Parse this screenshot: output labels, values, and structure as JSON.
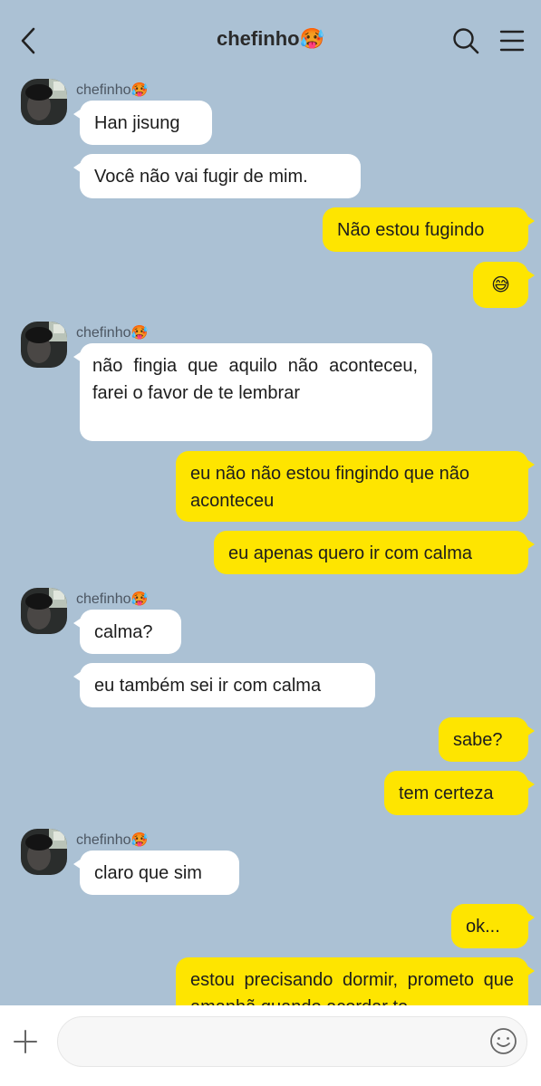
{
  "header": {
    "title": "chefinho",
    "title_emoji": "🥵"
  },
  "messages": [
    {
      "sender": "chefinho",
      "sender_emoji": "🥵",
      "text": "Han jisung"
    },
    {
      "text": "Você não vai fugir de mim."
    },
    {
      "text": "Não estou fugindo"
    },
    {
      "text": "😅"
    },
    {
      "sender": "chefinho",
      "sender_emoji": "🥵",
      "text": "não fingia que aquilo não aconteceu, farei o favor de te lembrar"
    },
    {
      "text": "eu não não estou fingindo que não aconteceu"
    },
    {
      "text": "eu apenas quero ir com calma"
    },
    {
      "sender": "chefinho",
      "sender_emoji": "🥵",
      "text": "calma?"
    },
    {
      "text": "eu também sei ir com calma"
    },
    {
      "text": "sabe?"
    },
    {
      "text": "tem certeza"
    },
    {
      "sender": "chefinho",
      "sender_emoji": "🥵",
      "text": "claro que sim"
    },
    {
      "text": "ok..."
    },
    {
      "text": "estou precisando dormir, prometo que amanhã quando acordar te"
    }
  ],
  "input": {
    "placeholder": ""
  },
  "icons": {
    "back": "chevron-left-icon",
    "search": "search-icon",
    "menu": "hamburger-menu-icon",
    "add": "plus-icon",
    "emoji": "smiley-icon"
  },
  "colors": {
    "background": "#abc1d4",
    "incoming_bubble": "#ffffff",
    "outgoing_bubble": "#fee500",
    "input_bar": "#ffffff"
  }
}
